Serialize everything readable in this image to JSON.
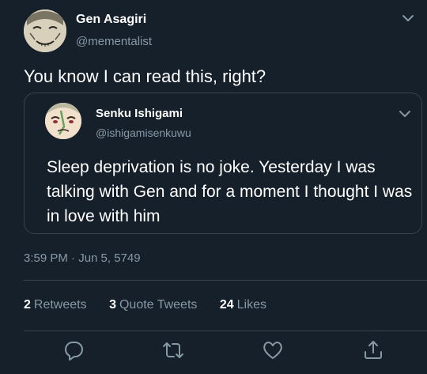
{
  "tweet": {
    "author": {
      "name": "Gen Asagiri",
      "handle": "@mementalist",
      "avatar_icon": "profile-avatar"
    },
    "text": "You know I can read this, right?",
    "quoted": {
      "name": "Senku Ishigami",
      "handle": "@ishigamisenkuwu",
      "avatar_icon": "profile-avatar",
      "text": "Sleep deprivation is no joke. Yesterday I was talking with Gen and for a moment I thought I was in love with him"
    },
    "timestamp": "3:59 PM · Jun 5, 5749",
    "stats": {
      "retweets_count": "2",
      "retweets_label": "Retweets",
      "quotes_count": "3",
      "quotes_label": "Quote Tweets",
      "likes_count": "24",
      "likes_label": "Likes"
    },
    "actions": [
      "reply-icon",
      "retweet-icon",
      "like-icon",
      "share-icon"
    ]
  },
  "theme": {
    "background": "#15202b",
    "text": "#ffffff",
    "secondary_text": "#8899a6",
    "border": "#38444d"
  }
}
